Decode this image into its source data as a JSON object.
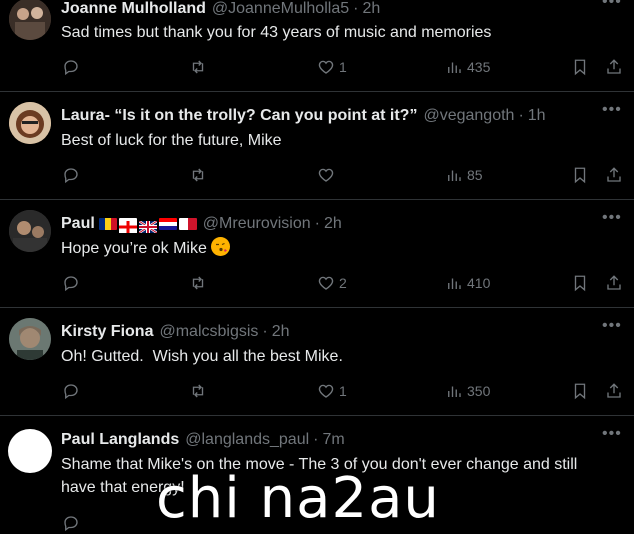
{
  "tweets": [
    {
      "name": "Joanne Mulholland",
      "handle": "@JoanneMulholla5",
      "time": "2h",
      "text": "Sad times but thank you for 43 years of music and memories",
      "likes": "1",
      "views": "435",
      "avatar_color": "#6b5a4c"
    },
    {
      "name": "Laura- “Is it on the trolly? Can you point at it?”",
      "handle": "@vegangoth",
      "time": "1h",
      "text": "Best of luck for the future, Mike",
      "likes": "",
      "views": "85",
      "avatar_color": "#b58a5c"
    },
    {
      "name": "Paul",
      "handle": "@Mreurovision",
      "time": "2h",
      "text": "Hope you’re ok Mike",
      "emoji": "face-blowing-kiss",
      "likes": "2",
      "views": "410",
      "avatar_color": "#4a4a4a"
    },
    {
      "name": "Kirsty Fiona",
      "handle": "@malcsbigsis",
      "time": "2h",
      "text": "Oh! Gutted.  Wish you all the best Mike.",
      "likes": "1",
      "views": "350",
      "avatar_color": "#3d4a45"
    },
    {
      "name": "Paul Langlands",
      "handle": "@langlands_paul",
      "time": "7m",
      "text": "Shame that Mike's on the move - The 3 of you don't ever change and still have that energy!",
      "avatar_color": "#ffffff"
    }
  ],
  "separator": "·",
  "watermark": "chi na2au",
  "colors": {
    "background": "#000000",
    "text": "#e7e9ea",
    "muted": "#71767b",
    "divider": "#2f3336"
  }
}
